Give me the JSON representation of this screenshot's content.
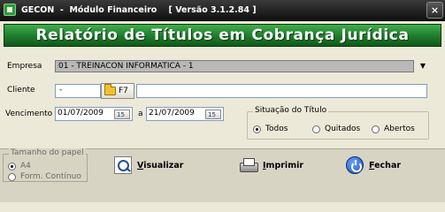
{
  "window": {
    "title": "GECON  -  Módulo Financeiro    [ Versão 3.1.2.84 ]",
    "close_glyph": "×"
  },
  "banner": {
    "title": "Relatório de Títulos em Cobrança Jurídica"
  },
  "form": {
    "empresa_label": "Empresa",
    "empresa_value": "01 - TREINACON INFORMATICA - 1",
    "empresa_chevron": "▼",
    "cliente_label": "Cliente",
    "cliente_code": "-",
    "cliente_lookup_label": "F7",
    "cliente_name": "",
    "vencimento_label": "Vencimento",
    "date_from": "01/07/2009",
    "date_separator": "a",
    "date_to": "21/07/2009",
    "calendar_glyph": "15"
  },
  "situacao": {
    "legend": "Situação do Título",
    "options": [
      {
        "label": "Todos",
        "checked": true
      },
      {
        "label": "Quitados",
        "checked": false
      },
      {
        "label": "Abertos",
        "checked": false
      }
    ]
  },
  "papel": {
    "legend": "Tamanho do papel",
    "options": [
      {
        "label": "A4",
        "checked": true
      },
      {
        "label": "Form. Contínuo",
        "checked": false
      }
    ]
  },
  "actions": {
    "visualizar": {
      "label_first": "V",
      "label_rest": "isualizar",
      "icon": "magnifier-icon"
    },
    "imprimir": {
      "label_first": "I",
      "label_rest": "mprimir",
      "icon": "printer-icon"
    },
    "fechar": {
      "label_first": "F",
      "label_rest": "echar",
      "icon": "power-icon"
    }
  },
  "colors": {
    "banner_green": "#1f7a2b",
    "titlebar_dark": "#1a1a1a",
    "form_bg": "#ece9d8"
  }
}
